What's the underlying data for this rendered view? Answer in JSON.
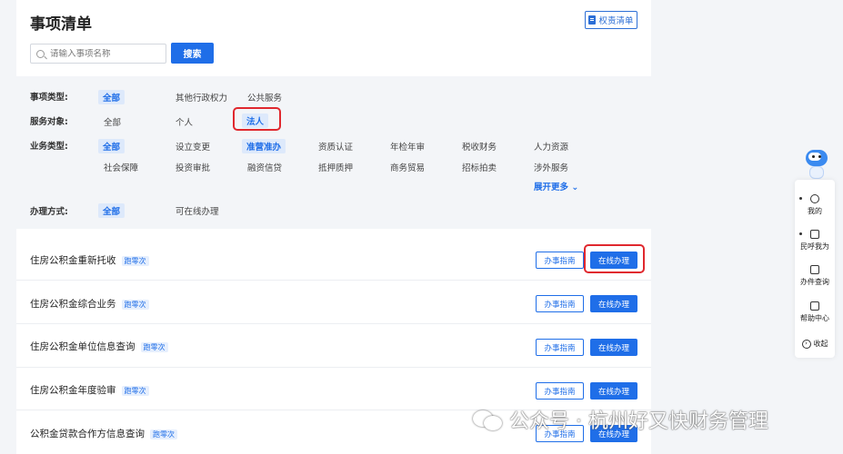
{
  "header": {
    "title": "事项清单",
    "rights_list_label": "权责清单"
  },
  "search": {
    "placeholder": "请输入事项名称",
    "button_label": "搜索"
  },
  "filters": {
    "item_type": {
      "label": "事项类型:",
      "options": [
        "全部",
        "其他行政权力",
        "公共服务"
      ],
      "selected": "全部"
    },
    "service_target": {
      "label": "服务对象:",
      "options": [
        "全部",
        "个人",
        "法人"
      ],
      "selected": "法人"
    },
    "business_type": {
      "label": "业务类型:",
      "options": [
        "全部",
        "设立变更",
        "准营准办",
        "资质认证",
        "年检年审",
        "税收财务",
        "人力资源",
        "社会保障",
        "投资审批",
        "融资信贷",
        "抵押质押",
        "商务贸易",
        "招标拍卖",
        "涉外服务"
      ],
      "selected": [
        "全部",
        "准营准办"
      ],
      "expand_label": "展开更多"
    },
    "handling_method": {
      "label": "办理方式:",
      "options": [
        "全部",
        "可在线办理"
      ],
      "selected": "全部"
    }
  },
  "items": [
    {
      "name": "住房公积金重新托收",
      "badge": "跑零次",
      "guide": "办事指南",
      "online": "在线办理"
    },
    {
      "name": "住房公积金综合业务",
      "badge": "跑零次",
      "guide": "办事指南",
      "online": "在线办理"
    },
    {
      "name": "住房公积金单位信息查询",
      "badge": "跑零次",
      "guide": "办事指南",
      "online": "在线办理"
    },
    {
      "name": "住房公积金年度验审",
      "badge": "跑零次",
      "guide": "办事指南",
      "online": "在线办理"
    },
    {
      "name": "公积金贷款合作方信息查询",
      "badge": "跑零次",
      "guide": "办事指南",
      "online": "在线办理"
    }
  ],
  "sidebar": {
    "items": [
      {
        "label": "我的",
        "icon": "user-icon"
      },
      {
        "label": "民呼我为",
        "icon": "message-icon"
      },
      {
        "label": "办件查询",
        "icon": "file-search-icon"
      },
      {
        "label": "帮助中心",
        "icon": "book-icon"
      },
      {
        "label": "收起",
        "icon": "collapse-icon"
      }
    ]
  },
  "watermark": {
    "text": "公众号 · 杭州好又快财务管理"
  },
  "colors": {
    "primary": "#1f6ee8",
    "highlight_border": "#e0282e",
    "filter_bg": "#f3f5f8"
  }
}
